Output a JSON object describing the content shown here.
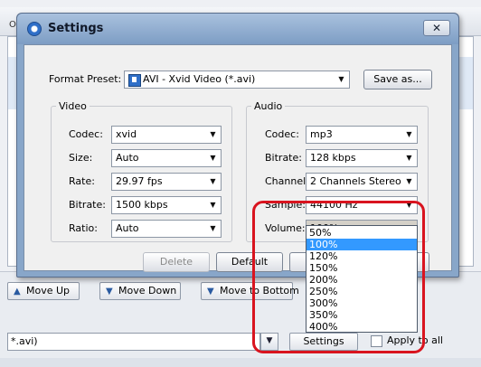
{
  "background": {
    "tab_fragment": "Ori",
    "buttons": [
      {
        "label": "Move Up",
        "icon": "arrow-up-icon"
      },
      {
        "label": "Move Down",
        "icon": "arrow-down-icon"
      },
      {
        "label": "Move to Bottom",
        "icon": "arrow-down-bottom-icon"
      }
    ],
    "format_fragment": "*.avi)",
    "settings_label": "Settings",
    "apply_all_label": "Apply to all"
  },
  "dialog": {
    "title": "Settings",
    "close_glyph": "✕",
    "format_preset_label": "Format Preset:",
    "format_preset_value": "AVI - Xvid Video (*.avi)",
    "save_as_label": "Save as...",
    "video": {
      "legend": "Video",
      "codec_label": "Codec:",
      "codec_value": "xvid",
      "size_label": "Size:",
      "size_value": "Auto",
      "rate_label": "Rate:",
      "rate_value": "29.97 fps",
      "bitrate_label": "Bitrate:",
      "bitrate_value": "1500 kbps",
      "ratio_label": "Ratio:",
      "ratio_value": "Auto"
    },
    "audio": {
      "legend": "Audio",
      "codec_label": "Codec:",
      "codec_value": "mp3",
      "bitrate_label": "Bitrate:",
      "bitrate_value": "128 kbps",
      "channel_label": "Channel:",
      "channel_value": "2 Channels Stereo",
      "sample_label": "Sample:",
      "sample_value": "44100 Hz",
      "volume_label": "Volume:",
      "volume_value": "100%"
    },
    "delete_label": "Delete",
    "default_label": "Default"
  },
  "volume_options": [
    "50%",
    "100%",
    "120%",
    "150%",
    "200%",
    "250%",
    "300%",
    "350%",
    "400%"
  ],
  "volume_selected_index": 1,
  "colors": {
    "highlight": "#d9141f",
    "selection": "#3399ff",
    "titlebar": "#88a6c9"
  }
}
